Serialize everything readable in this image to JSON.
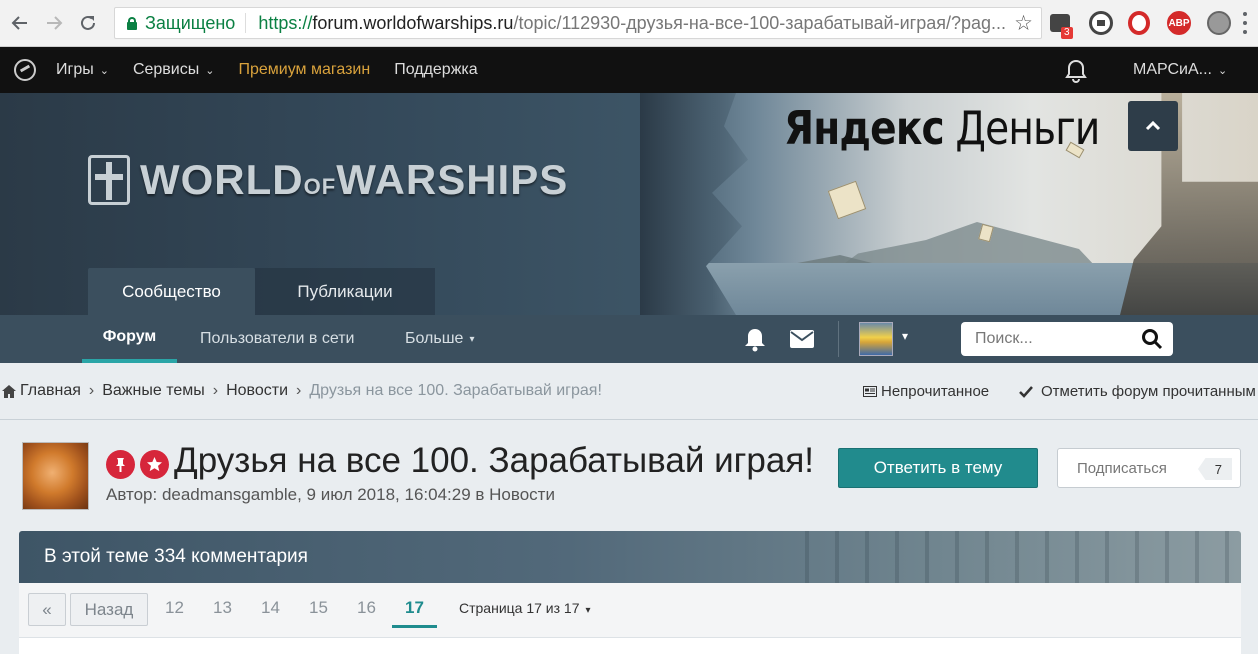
{
  "browser": {
    "secure_label": "Защищено",
    "url_scheme": "https://",
    "url_host": "forum.worldofwarships.ru",
    "url_path": "/topic/112930-друзья-на-все-100-зарабатывай-играя/?pag...",
    "extension_badge": "3",
    "abp_label": "ABP",
    "icons": [
      "back-icon",
      "forward-icon",
      "reload-icon",
      "lock-icon",
      "star-icon",
      "menu-icon"
    ]
  },
  "topnav": {
    "items": [
      {
        "label": "Игры",
        "caret": "⌄"
      },
      {
        "label": "Сервисы",
        "caret": "⌄"
      },
      {
        "label": "Премиум магазин"
      },
      {
        "label": "Поддержка"
      }
    ],
    "user": "МАРСиА...",
    "user_caret": "⌄"
  },
  "banner": {
    "logo_main": "WORLD",
    "logo_of": "OF",
    "logo_end": "WARSHIPS",
    "ad_prefix": "Яндекс",
    "ad_suffix": " Деньги"
  },
  "tabs": {
    "community": "Сообщество",
    "publications": "Публикации"
  },
  "subnav": {
    "forum": "Форум",
    "online": "Пользователи в сети",
    "more": "Больше",
    "more_caret": "▾",
    "avatar_caret": "▾",
    "search_placeholder": "Поиск..."
  },
  "breadcrumbs": {
    "items": [
      "Главная",
      "Важные темы",
      "Новости"
    ],
    "current": "Друзья на все 100. Зарабатывай играя!",
    "sep": "›",
    "unread": "Непрочитанное",
    "mark_read": "Отметить форум прочитанным"
  },
  "topic": {
    "title": "Друзья на все 100. Зарабатывай играя!",
    "meta": "Автор: deadmansgamble, 9 июл 2018, 16:04:29 в Новости",
    "reply_button": "Ответить в тему",
    "follow_button": "Подписаться",
    "follow_count": "7"
  },
  "comments": {
    "header": "В этой теме 334 комментария"
  },
  "pagination": {
    "first": "«",
    "prev": "Назад",
    "pages": [
      "12",
      "13",
      "14",
      "15",
      "16",
      "17"
    ],
    "current": "17",
    "jump": "Страница 17 из 17",
    "jump_caret": "▾"
  },
  "colors": {
    "accent": "#218b8d",
    "nav_dark": "#111111",
    "subnav": "#3b4f5e",
    "premium": "#d9a23c",
    "badge_red": "#d6263b"
  }
}
